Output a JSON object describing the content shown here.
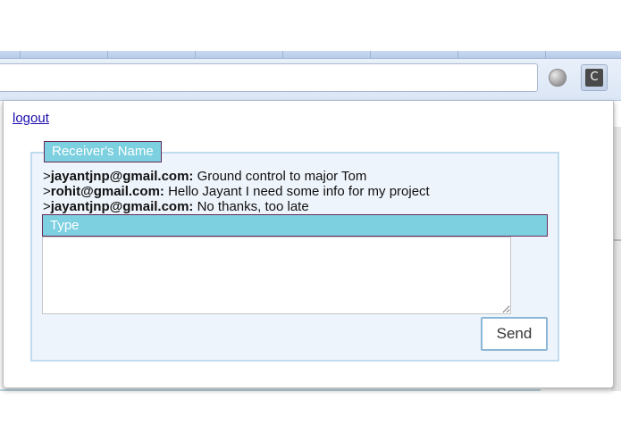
{
  "browser": {
    "extension_icon": {
      "icon": "c-letter-icon",
      "label": "C"
    },
    "globe_icon": "globe-icon"
  },
  "popup": {
    "logout_label": "logout",
    "receiver_name_label": "Receiver's Name",
    "messages": [
      {
        "sender": "jayantjnp@gmail.com:",
        "text": " Ground control to major Tom"
      },
      {
        "sender": "rohit@gmail.com:",
        "text": " Hello Jayant I need some info for my project"
      },
      {
        "sender": "jayantjnp@gmail.com:",
        "text": " No thanks, too late"
      }
    ],
    "message_prefix": ">",
    "type_label": "Type",
    "message_input_value": "",
    "send_label": "Send"
  },
  "colors": {
    "label_bar": "#7cd0e0",
    "label_border": "#6a2a5a",
    "panel_bg": "#eef4fb",
    "panel_border": "#bfdcef",
    "link": "#1a0dab"
  }
}
